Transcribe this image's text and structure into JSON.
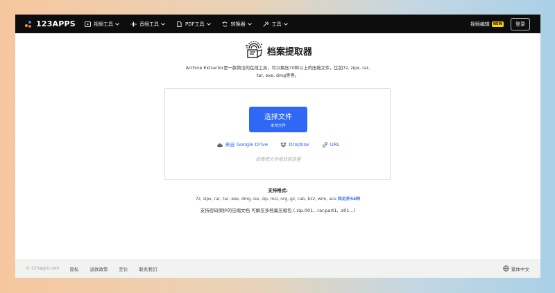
{
  "brand": {
    "logo_text": "123APPS"
  },
  "nav": {
    "items": [
      {
        "label": "视频工具",
        "icon": "video-icon"
      },
      {
        "label": "音频工具",
        "icon": "audio-wave-icon"
      },
      {
        "label": "PDF工具",
        "icon": "pdf-icon"
      },
      {
        "label": "转换器",
        "icon": "convert-icon"
      },
      {
        "label": "工具",
        "icon": "tools-icon"
      }
    ],
    "video_editor": "视频编辑",
    "new_badge": "NEW",
    "login": "登录"
  },
  "app": {
    "title": "档案提取器",
    "description_line1": "Archive Extractor是一款简洁的在线工具，可以解压70种以上的压缩文件，比如7z, zipx, rar,",
    "description_line2": "tar, exe, dmg等等。"
  },
  "upload": {
    "choose_label": "选择文件",
    "choose_sub": "本地文件",
    "google_drive": "来自 Google Drive",
    "dropbox": "Dropbox",
    "url": "URL",
    "drop_hint": "或者把文件拖放到这里"
  },
  "formats": {
    "title": "支持格式:",
    "list": "7z, zipx, rar, tar, exe, dmg, iso, zip, msi, nrg, gz, cab, bz2, wim, ace",
    "more": "和另外54种",
    "note": "支持密码保护的压缩文档 可解压多档案压缩包 (.zip.001, .rar.part1, .z01...)"
  },
  "footer": {
    "copyright": "© 123apps.com",
    "links": [
      "隐私",
      "退款政策",
      "定价",
      "联系我们"
    ],
    "language": "繁体中文"
  },
  "colors": {
    "accent": "#2f68f5",
    "topbar": "#0d0d0d",
    "badge": "#ffd400"
  }
}
